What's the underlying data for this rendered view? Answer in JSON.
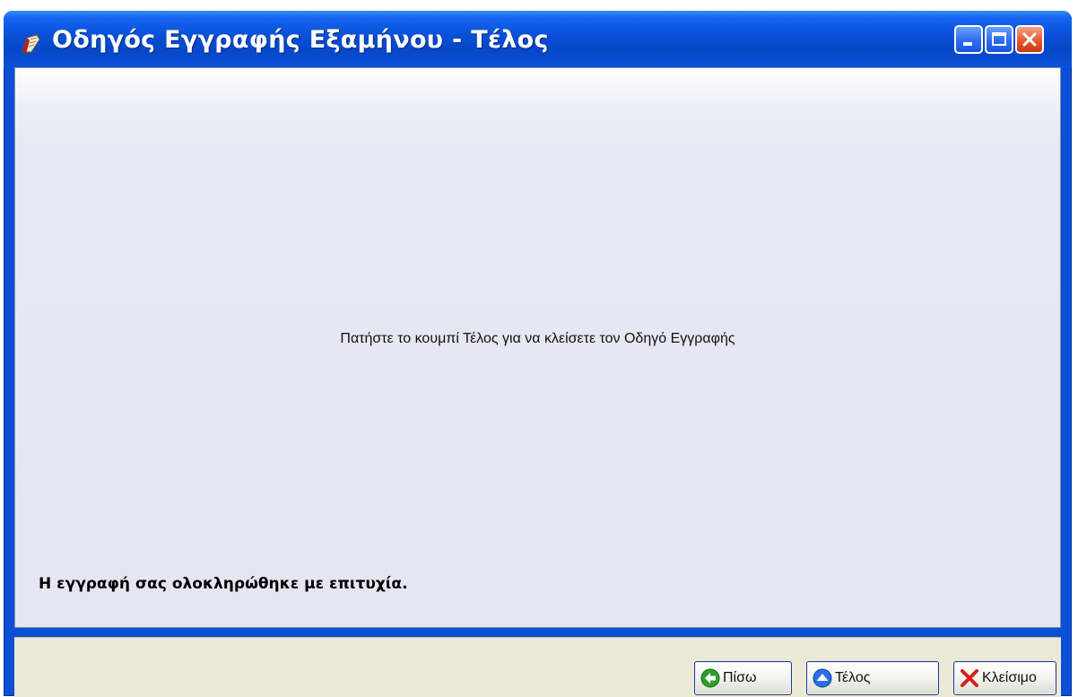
{
  "window": {
    "title": "Οδηγός Εγγραφής Εξαμήνου - Τέλος"
  },
  "content": {
    "instruction": "Πατήστε το κουμπί Τέλος για να κλείσετε τον Οδηγό Εγγραφής",
    "success_message": "Η εγγραφή σας ολοκληρώθηκε με επιτυχία."
  },
  "footer": {
    "back_label": "Πίσω",
    "finish_label": "Τέλος",
    "close_label": "Κλείσιμο"
  },
  "icons": {
    "app": "app-icon",
    "back": "green-left-arrow-icon",
    "finish": "blue-up-arrow-icon",
    "close": "red-x-icon"
  },
  "colors": {
    "titlebar": "#0a4fd6",
    "content_bg": "#e8e8f4",
    "footer_bg": "#ece9d8"
  }
}
